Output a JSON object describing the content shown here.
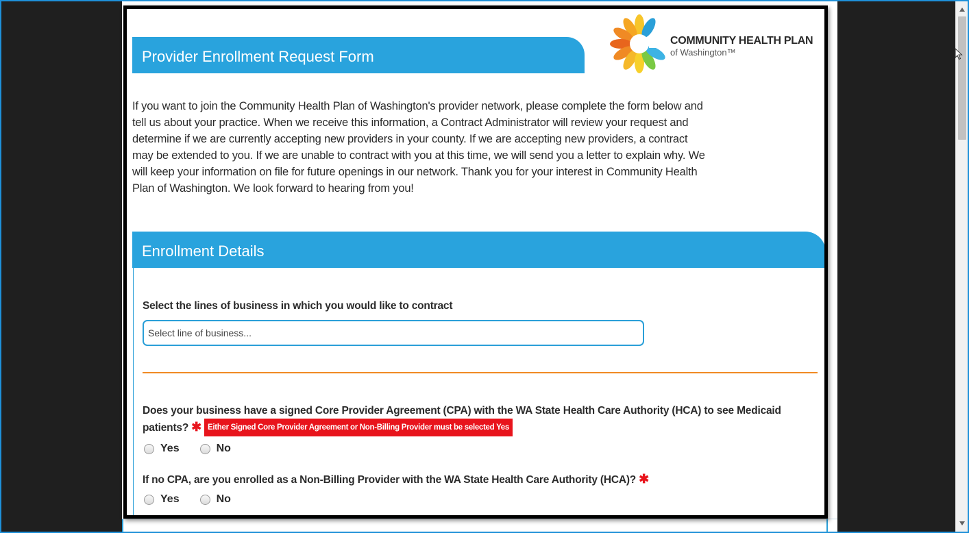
{
  "form": {
    "title": "Provider Enrollment Request Form",
    "intro": "If you want to join the Community Health Plan of Washington's provider network, please complete the form below and tell us about your practice. When we receive this information, a Contract Administrator will review your request and determine if we are currently accepting new providers in your county. If we are accepting new providers, a contract may be extended to you. If we are unable to contract with you at this time, we will send you a letter to explain why. We will keep your information on file for future openings in our network. Thank you for your interest in Community Health Plan of Washington. We look forward to hearing from you!"
  },
  "logo": {
    "name": "COMMUNITY HEALTH PLAN",
    "sub": "of Washington™"
  },
  "section": {
    "title": "Enrollment Details",
    "line_of_business": {
      "label": "Select the lines of business in which you would like to contract",
      "placeholder": "Select line of business..."
    },
    "cpa": {
      "question": "Does your business have a signed Core Provider Agreement (CPA) with the WA State Health Care Authority (HCA) to see Medicaid patients?",
      "required": "✱",
      "error": "Either Signed Core Provider Agreement or Non-Billing Provider must be selected Yes",
      "yes": "Yes",
      "no": "No"
    },
    "non_billing": {
      "question": "If no CPA, are you enrolled as a Non-Billing Provider with the WA State Health Care Authority (HCA)?",
      "required": "✱",
      "yes": "Yes",
      "no": "No"
    }
  },
  "colors": {
    "banner": "#29a3dd",
    "divider": "#f08a24",
    "error": "#e8141c",
    "frame": "#1e90d8"
  }
}
